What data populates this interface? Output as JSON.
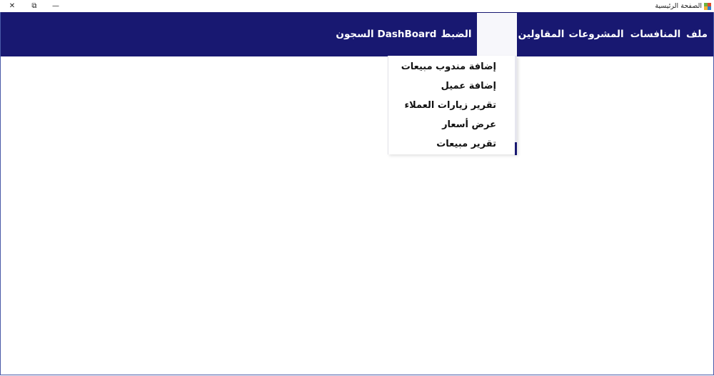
{
  "window": {
    "title": "الصفحة الرئيسية",
    "controls": {
      "close": "✕",
      "restore": "⧉",
      "minimize": "—"
    }
  },
  "menubar": {
    "background": "#181871",
    "items": [
      {
        "label": "ملف"
      },
      {
        "label": "المنافسات"
      },
      {
        "label": "المشروعات"
      },
      {
        "label": "المقاولين"
      },
      {
        "label": ""
      },
      {
        "label": "الضبط"
      },
      {
        "label": "DashBoard"
      },
      {
        "label": "السجون"
      }
    ]
  },
  "dropdown": {
    "items": [
      {
        "label": "إضافة مندوب مبيعات"
      },
      {
        "label": "إضافة عميل"
      },
      {
        "label": "تقرير زيارات العملاء"
      },
      {
        "label": "عرض أسعار"
      },
      {
        "label": "تقرير مبيعات"
      }
    ]
  }
}
